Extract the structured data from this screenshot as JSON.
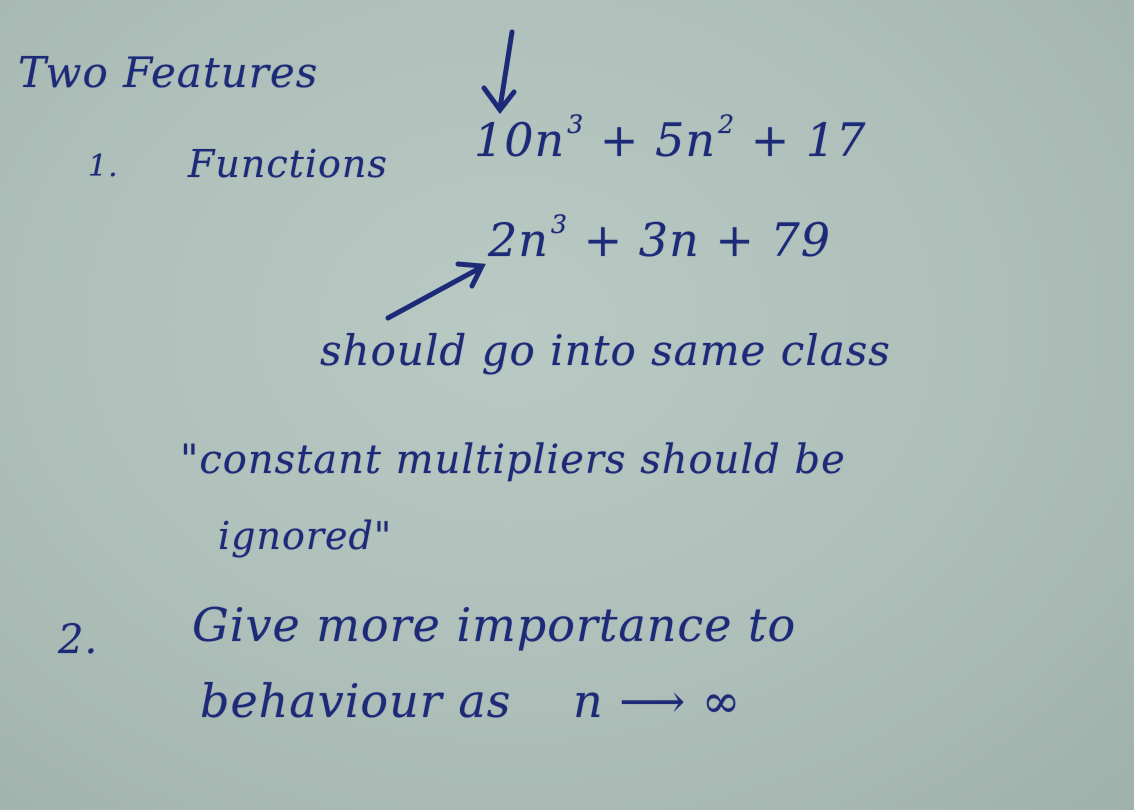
{
  "slide": {
    "heading": "Two Features",
    "item1": {
      "number": "1.",
      "label": "Functions",
      "expr1": {
        "a": "10n",
        "a_exp": "3",
        "b": "+ 5n",
        "b_exp": "2",
        "c": "+ 17"
      },
      "expr2": {
        "a": "2n",
        "a_exp": "3",
        "b": "+ 3n + 79"
      },
      "note": "should go into same class",
      "quote_line1": "\"constant multipliers should be",
      "quote_line2": "ignored\""
    },
    "item2": {
      "number": "2.",
      "line1": "Give more importance to",
      "line2_text": "behaviour as",
      "limit_var": "n",
      "limit_arrow": "⟶",
      "limit_value": "∞"
    }
  },
  "colors": {
    "ink": "#1d2a78",
    "board": "#aebfb9"
  }
}
